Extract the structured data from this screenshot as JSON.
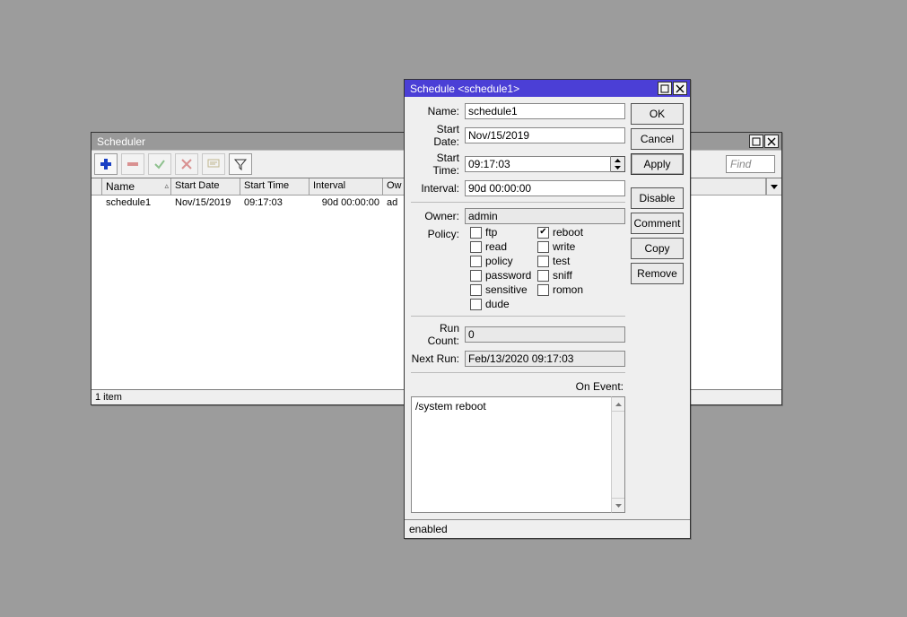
{
  "scheduler": {
    "title": "Scheduler",
    "find_placeholder": "Find",
    "columns": [
      "Name",
      "Start Date",
      "Start Time",
      "Interval",
      "Ow"
    ],
    "row": {
      "name": "schedule1",
      "start_date": "Nov/15/2019",
      "start_time": "09:17:03",
      "interval": "90d 00:00:00",
      "owner": "ad"
    },
    "status": "1 item"
  },
  "dialog": {
    "title": "Schedule <schedule1>",
    "labels": {
      "name": "Name:",
      "start_date": "Start Date:",
      "start_time": "Start Time:",
      "interval": "Interval:",
      "owner": "Owner:",
      "policy": "Policy:",
      "run_count": "Run Count:",
      "next_run": "Next Run:",
      "on_event": "On Event:"
    },
    "values": {
      "name": "schedule1",
      "start_date": "Nov/15/2019",
      "start_time": "09:17:03",
      "interval": "90d 00:00:00",
      "owner": "admin",
      "run_count": "0",
      "next_run": "Feb/13/2020 09:17:03",
      "on_event": "/system reboot"
    },
    "policy": [
      {
        "label": "ftp",
        "on": false
      },
      {
        "label": "reboot",
        "on": true
      },
      {
        "label": "read",
        "on": false
      },
      {
        "label": "write",
        "on": false
      },
      {
        "label": "policy",
        "on": false
      },
      {
        "label": "test",
        "on": false
      },
      {
        "label": "password",
        "on": false
      },
      {
        "label": "sniff",
        "on": false
      },
      {
        "label": "sensitive",
        "on": false
      },
      {
        "label": "romon",
        "on": false
      },
      {
        "label": "dude",
        "on": false
      }
    ],
    "buttons": {
      "ok": "OK",
      "cancel": "Cancel",
      "apply": "Apply",
      "disable": "Disable",
      "comment": "Comment",
      "copy": "Copy",
      "remove": "Remove"
    },
    "status": "enabled"
  }
}
